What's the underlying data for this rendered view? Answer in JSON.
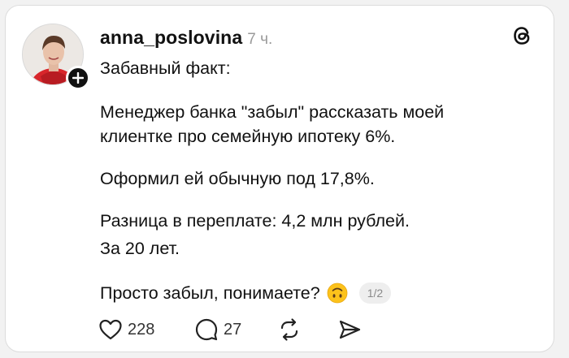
{
  "post": {
    "username": "anna_poslovina",
    "time": "7 ч.",
    "lines": [
      "Забавный факт:",
      "Менеджер банка \"забыл\" рассказать моей",
      "клиентке про семейную ипотеку 6%.",
      "Оформил ей обычную под 17,8%.",
      "Разница в переплате: 4,2 млн рублей.",
      "За 20 лет.",
      "Просто забыл, понимаете?"
    ],
    "emoji": "upside-down-face",
    "page_indicator": "1/2"
  },
  "actions": {
    "likes": "228",
    "comments": "27"
  },
  "icons": {
    "logo": "threads-logo-icon",
    "like": "heart-icon",
    "comment": "comment-bubble-icon",
    "repost": "repost-icon",
    "share": "send-icon",
    "follow": "plus-icon"
  },
  "colors": {
    "text": "#111111",
    "muted": "#9a9a9a",
    "avatar_accent": "#d8262b"
  }
}
